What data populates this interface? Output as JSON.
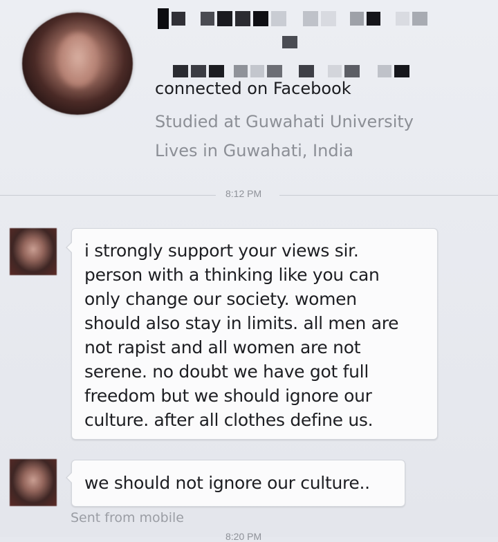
{
  "profile": {
    "name_redacted": "",
    "connected_text": "connected on Facebook",
    "studied": "Studied at Guwahati University",
    "lives": "Lives in Guwahati, India"
  },
  "divider": {
    "time": "8:12 PM"
  },
  "messages": [
    {
      "lines": [
        "i strongly support your views sir.",
        "person with a thinking like you can",
        "only change our society. women",
        "should also stay in limits. all men are",
        "not rapist and all women are not",
        "serene. no doubt we have got full",
        "freedom but we should ignore our",
        "culture. after all clothes define us."
      ]
    },
    {
      "lines": [
        "we should not ignore our culture.."
      ]
    }
  ],
  "footer": {
    "sent_from": "Sent from mobile",
    "next_time_partial": "8:20 PM"
  },
  "colors": {
    "background": "#e6e8ee",
    "bubble": "#fbfbfc",
    "secondary_text": "#8c8f96",
    "primary_text": "#1b1c20"
  }
}
